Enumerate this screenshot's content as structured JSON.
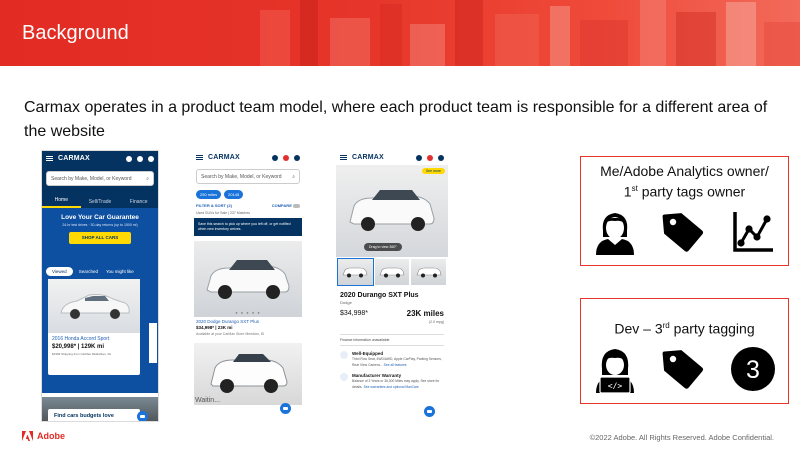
{
  "slide": {
    "title": "Background",
    "headline": "Carmax operates in a product team model, where each product team is responsible for a different area of the website",
    "footer_brand": "Adobe",
    "copyright": "©2022 Adobe. All Rights Reserved. Adobe Confidential.",
    "colors": {
      "brand_red": "#e22b23",
      "carmax_navy": "#053361",
      "carmax_yellow": "#ffd900"
    }
  },
  "phone_home": {
    "logo": "CARMAX",
    "search_placeholder": "Search by Make, Model, or Keyword",
    "tabs": [
      "Home",
      "Sell/Trade",
      "Finance"
    ],
    "promo_title": "Love Your Car Guarantee",
    "promo_sub": "24-hr test drives  ·  30-day returns (up to 1500 mi)",
    "promo_button": "SHOP ALL CARS",
    "pills": [
      "Viewed",
      "Searched",
      "You might like"
    ],
    "card_title": "2016 Honda Accord Sport",
    "card_price": "$20,998* | 129K mi",
    "card_fine": "$1999 Shipping from CarMax Midlothian, VA",
    "feedback": "FEEDBACK",
    "bottom_card": "Find cars budgets love"
  },
  "phone_search": {
    "logo": "CARMAX",
    "search_placeholder": "Search by Make, Model, or Keyword",
    "chips": [
      "250 miles",
      "20145"
    ],
    "filter_label": "FILTER & SORT (2)",
    "compare_label": "COMPARE",
    "meta": "Used SUVs for Sale  |  237 Matches",
    "save_notice": "Save this search to pick up where you left off, or get notified when new inventory arrives.",
    "listing_title": "2020 Dodge Durango SXT Plus",
    "listing_price": "$34,998* | 23K mi",
    "listing_store": "Available at your CarMax Store Meridian, ID",
    "waiting": "Waitin..."
  },
  "phone_detail": {
    "logo": "CARMAX",
    "see_more": "See more",
    "drag_label": "Drag to view 360°",
    "title": "2020 Durango SXT Plus",
    "make": "Dodge",
    "price": "$34,998*",
    "miles": "23K miles",
    "miles_note": "(2.0 mpg)",
    "finance": "Finance information unavailable",
    "feature1_title": "Well-Equipped",
    "feature1_text": "Third Row Seat, 4WD/AWD, Apple CarPlay, Parking Sensors, Rear View Camera...",
    "feature1_link": "See all features",
    "feature2_title": "Manufacturer Warranty",
    "feature2_text": "Balance of 3 Years or 36,000 Miles may apply. See store for details.",
    "feature2_link": "See warranties and optional MaxCare"
  },
  "role_boxes": [
    {
      "label_line1": "Me/Adobe Analytics owner/",
      "label_line2_num": "1",
      "label_line2_sup": "st",
      "label_line2_rest": " party tags owner",
      "icons": [
        "person-icon",
        "tag-icon",
        "line-chart-icon"
      ]
    },
    {
      "label_pre": "Dev – 3",
      "label_sup": "rd",
      "label_post": " party tagging",
      "icons": [
        "developer-icon",
        "tag-icon",
        "number-three-icon"
      ],
      "badge_number": "3"
    }
  ]
}
